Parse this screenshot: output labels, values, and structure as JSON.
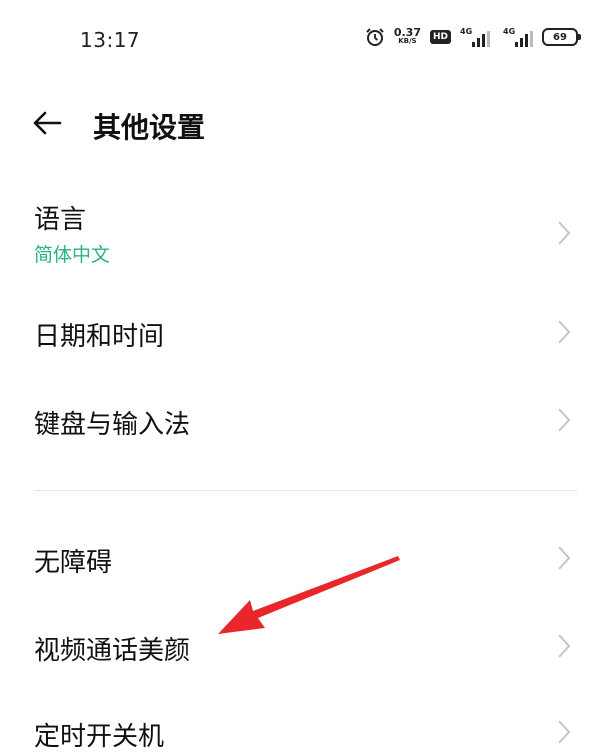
{
  "status_bar": {
    "time": "13:17",
    "net_speed_value": "0.37",
    "net_speed_unit": "KB/S",
    "hd_label": "HD",
    "signal_1_label": "4G",
    "signal_2_label": "4G",
    "battery_level": "69"
  },
  "header": {
    "title": "其他设置"
  },
  "settings": {
    "items": [
      {
        "label": "语言",
        "sub": "简体中文"
      },
      {
        "label": "日期和时间"
      },
      {
        "label": "键盘与输入法"
      },
      {
        "label": "无障碍"
      },
      {
        "label": "视频通话美颜"
      },
      {
        "label": "定时开关机"
      }
    ]
  },
  "colors": {
    "accent": "#2bb57a",
    "annotation_arrow": "#e8262b"
  }
}
